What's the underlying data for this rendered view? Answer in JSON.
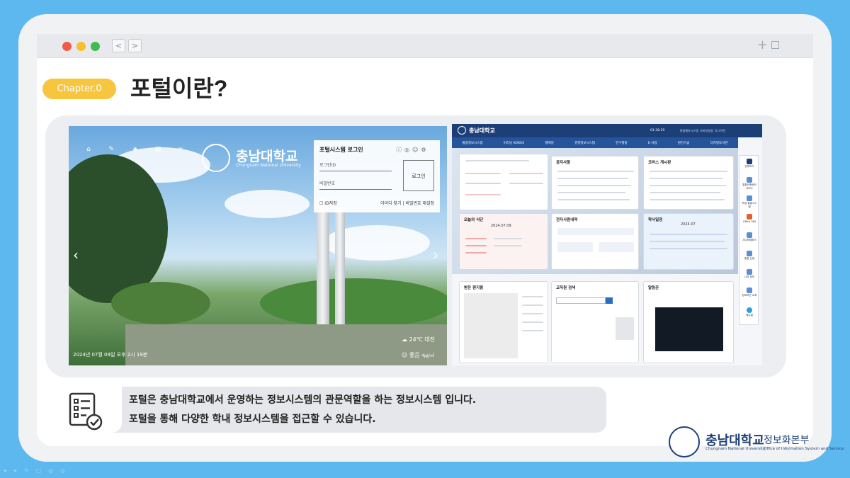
{
  "chapter_badge": "Chapter.0",
  "title": "포털이란?",
  "left_screenshot": {
    "brand": "충남대학교",
    "brand_sub": "Chungnam National University",
    "login_title": "포털시스템 로그인",
    "id_placeholder": "로그인ID",
    "pw_placeholder": "비밀번호",
    "login_button": "로그인",
    "save_id": "ID저장",
    "links": "아이디 찾기 | 비밀번호 재설정",
    "datetime": "2024년 07월 09일 오후 2시 19분",
    "weather": "24℃ 대전",
    "dust_label": "좋음",
    "dust_value": "4㎍/㎥"
  },
  "right_screenshot": {
    "brand": "충남대학교",
    "time": "01:38:39",
    "top_links": "통합예약시스템  모바일설정  로그아웃",
    "nav": [
      "통합정보시스템",
      "이러닝 KORUS",
      "웹메일",
      "경영정보시스템",
      "연구행정",
      "E-사업",
      "원전기금",
      "디지털도서관"
    ],
    "notice_title": "공지사항",
    "korus_title": "코러스 게시판",
    "meal_title": "오늘의 식단",
    "meal_date": "2024.07.09",
    "event_title": "전자사원내역",
    "schedule_title": "학사일정",
    "schedule_date": "2024.07",
    "mail_title": "받은 편지함",
    "staff_title": "교직원 검색",
    "alarm_title": "알림존",
    "sidebar": [
      "전체보기",
      "통합인증센터 서비스",
      "학생 출결시스템",
      "Office 365",
      "사이버캠퍼스",
      "증명 신청",
      "나의 정보",
      "정보보안 교육",
      "메뉴얼"
    ]
  },
  "note": {
    "line1": "포털은 충남대학교에서 운영하는 정보시스템의 관문역할을 하는 정보시스템 입니다.",
    "line2": "포털을 통해 다양한 학내 정보시스템을 접근할 수 있습니다."
  },
  "footer": {
    "name": "충남대학교",
    "dept": "정보화본부",
    "name_en": "Chungnam National University",
    "dept_en": "Office of Information System and Service"
  },
  "colors": {
    "background": "#5cb8ef",
    "badge": "#f7c63e",
    "portal_navy": "#1d3f78"
  }
}
